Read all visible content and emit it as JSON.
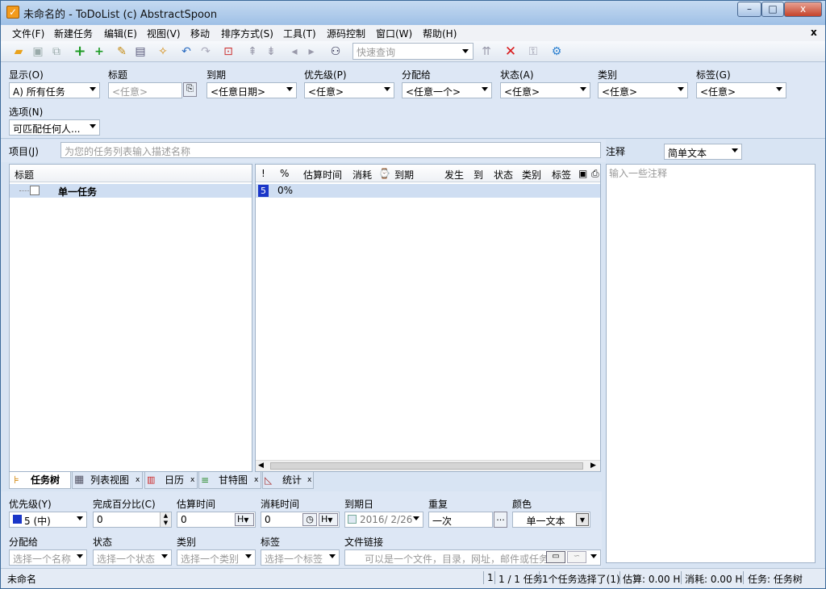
{
  "window": {
    "title": "未命名的 - ToDoList (c) AbstractSpoon",
    "app_icon": "checkbox-icon",
    "min_label": "–",
    "max_label": "□",
    "close_label": "x"
  },
  "menu": {
    "items": [
      "文件(F)",
      "新建任务",
      "编辑(E)",
      "视图(V)",
      "移动",
      "排序方式(S)",
      "工具(T)",
      "源码控制",
      "窗口(W)",
      "帮助(H)"
    ],
    "close": "x"
  },
  "toolbar": {
    "quick_search_placeholder": "快速查询",
    "icons": [
      "open-folder-icon",
      "save-icon",
      "save-all-icon",
      "add-task-icon",
      "add-subtask-icon",
      "edit-pencil-icon",
      "task-details-icon",
      "cleanup-icon",
      "undo-icon",
      "redo-icon",
      "goto-icon",
      "move-up-icon",
      "move-down-icon",
      "back-icon",
      "forward-icon",
      "find-binoculars-icon",
      "sort-icon",
      "delete-icon",
      "lock-icon",
      "settings-gear-icon"
    ]
  },
  "filter": {
    "show_label": "显示(O)",
    "show_value": "A) 所有任务",
    "title_label": "标题",
    "title_placeholder": "<任意>",
    "due_label": "到期",
    "due_value": "<任意日期>",
    "priority_label": "优先级(P)",
    "priority_value": "<任意>",
    "assigned_label": "分配给",
    "assigned_value": "<任意一个>",
    "status_label": "状态(A)",
    "status_value": "<任意>",
    "category_label": "类别",
    "category_value": "<任意>",
    "tags_label": "标签(G)",
    "tags_value": "<任意>",
    "options_label": "选项(N)",
    "options_value": "可匹配任何人..."
  },
  "project": {
    "label": "项目(J)",
    "placeholder": "为您的任务列表输入描述名称"
  },
  "tree": {
    "header": "标题",
    "task_title": "单一任务"
  },
  "grid": {
    "headers": [
      "!",
      "%",
      "估算时间",
      "消耗",
      "⌚",
      "到期",
      "发生",
      "到",
      "状态",
      "类别",
      "标签",
      "▣",
      "⎙"
    ],
    "row": {
      "priority": "5",
      "percent": "0%"
    }
  },
  "notes": {
    "label": "注释",
    "format": "简单文本",
    "placeholder": "输入一些注释"
  },
  "tabs": [
    "任务树",
    "列表视图",
    "日历",
    "甘特图",
    "统计"
  ],
  "props": {
    "priority_label": "优先级(Y)",
    "priority_value": "5 (中)",
    "percent_label": "完成百分比(C)",
    "percent_value": "0",
    "estimate_label": "估算时间",
    "estimate_value": "0",
    "estimate_unit": "H",
    "spent_label": "消耗时间",
    "spent_value": "0",
    "spent_unit": "H",
    "due_label": "到期日",
    "due_value": "2016/ 2/26",
    "recur_label": "重复",
    "recur_value": "一次",
    "recur_btn": "...",
    "color_label": "颜色",
    "color_value": "单一文本",
    "assigned_label": "分配给",
    "assigned_placeholder": "选择一个名称",
    "status_label": "状态",
    "status_placeholder": "选择一个状态",
    "category_label": "类别",
    "category_placeholder": "选择一个类别",
    "tags_label": "标签",
    "tags_placeholder": "选择一个标签",
    "link_label": "文件链接",
    "link_placeholder": "可以是一个文件，目录，网址，邮件或任务"
  },
  "status": {
    "file": "未命名",
    "count": "1",
    "tasks": "1 / 1 任务",
    "selected": "1个任务选择了(1)",
    "estimate": "估算: 0.00 H",
    "spent": "消耗: 0.00 H",
    "view": "任务: 任务树"
  }
}
